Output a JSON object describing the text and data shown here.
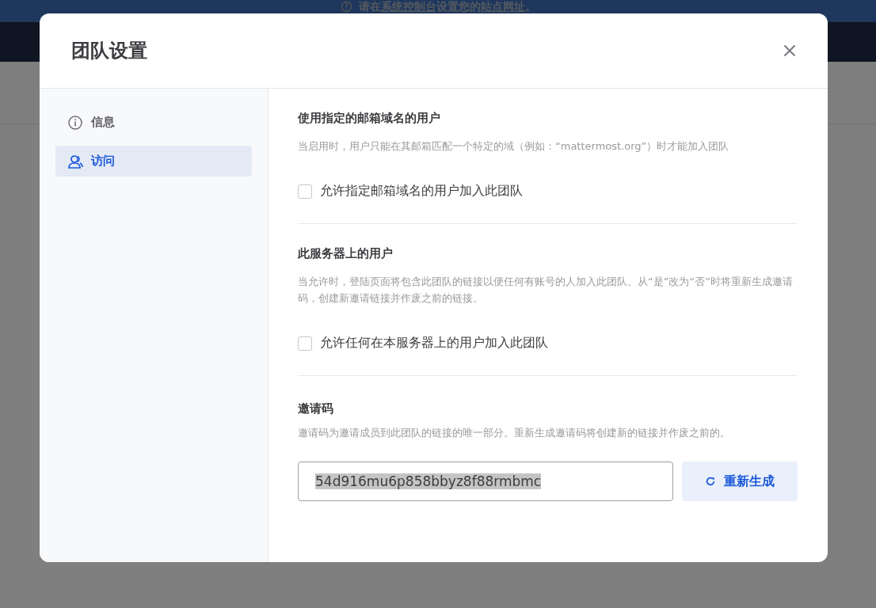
{
  "banner": {
    "parts": [
      {
        "kind": "text",
        "text": "请在"
      },
      {
        "kind": "link",
        "text": "系统控制台"
      },
      {
        "kind": "text",
        "text": "设置您的"
      },
      {
        "kind": "link",
        "text": "站点网址"
      },
      {
        "kind": "text",
        "text": "。"
      }
    ]
  },
  "modal": {
    "title": "团队设置",
    "sidebar": {
      "items": [
        {
          "label": "信息",
          "selected": false
        },
        {
          "label": "访问",
          "selected": true
        }
      ]
    },
    "sections": [
      {
        "kind": "checkbox",
        "title": "使用指定的邮箱域名的用户",
        "description": "当启用时，用户只能在其邮箱匹配一个特定的域（例如：“mattermost.org”）时才能加入团队",
        "checkbox": {
          "label": "允许指定邮箱域名的用户加入此团队",
          "checked": false
        }
      },
      {
        "kind": "checkbox",
        "title": "此服务器上的用户",
        "description": "当允许时，登陆页面将包含此团队的链接以便任何有账号的人加入此团队。从“是”改为“否”时将重新生成邀请码，创建新邀请链接并作废之前的链接。",
        "checkbox": {
          "label": "允许任何在本服务器上的用户加入此团队",
          "checked": false
        }
      },
      {
        "kind": "code",
        "title": "邀请码",
        "description": "邀请码为邀请成员到此团队的链接的唯一部分。重新生成邀请码将创建新的链接并作废之前的。",
        "value": "54d916mu6p858bbyz8f88rmbmc",
        "button": "重新生成"
      }
    ]
  }
}
